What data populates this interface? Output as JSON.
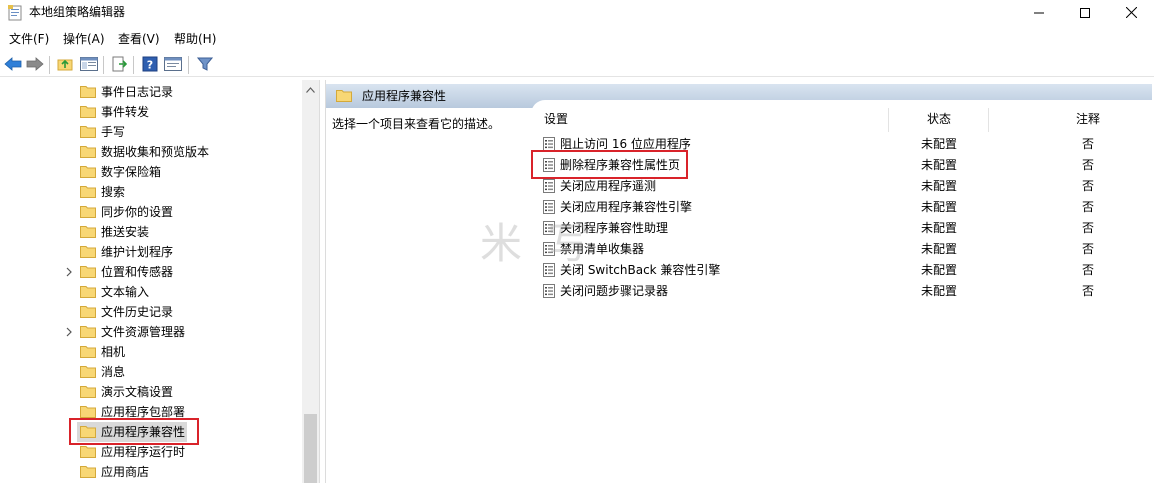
{
  "window": {
    "title": "本地组策略编辑器",
    "minimize_icon": "minimize-icon",
    "maximize_icon": "maximize-icon",
    "close_icon": "close-icon"
  },
  "menu": {
    "items": [
      "文件(F)",
      "操作(A)",
      "查看(V)",
      "帮助(H)"
    ]
  },
  "toolbar": {
    "icons": [
      "back-arrow-icon",
      "forward-arrow-icon",
      "up-folder-icon",
      "show-hide-tree-icon",
      "export-list-icon",
      "help-icon",
      "properties-icon",
      "filter-icon"
    ]
  },
  "tree": {
    "items": [
      {
        "label": "事件日志记录",
        "expandable": false
      },
      {
        "label": "事件转发",
        "expandable": false
      },
      {
        "label": "手写",
        "expandable": false
      },
      {
        "label": "数据收集和预览版本",
        "expandable": false
      },
      {
        "label": "数字保险箱",
        "expandable": false
      },
      {
        "label": "搜索",
        "expandable": false
      },
      {
        "label": "同步你的设置",
        "expandable": false
      },
      {
        "label": "推送安装",
        "expandable": false
      },
      {
        "label": "维护计划程序",
        "expandable": false
      },
      {
        "label": "位置和传感器",
        "expandable": true
      },
      {
        "label": "文本输入",
        "expandable": false
      },
      {
        "label": "文件历史记录",
        "expandable": false
      },
      {
        "label": "文件资源管理器",
        "expandable": true
      },
      {
        "label": "相机",
        "expandable": false
      },
      {
        "label": "消息",
        "expandable": false
      },
      {
        "label": "演示文稿设置",
        "expandable": false
      },
      {
        "label": "应用程序包部署",
        "expandable": false
      },
      {
        "label": "应用程序兼容性",
        "expandable": false,
        "selected": true
      },
      {
        "label": "应用程序运行时",
        "expandable": false
      },
      {
        "label": "应用商店",
        "expandable": false
      }
    ]
  },
  "pane": {
    "header_title": "应用程序兼容性",
    "description": "选择一个项目来查看它的描述。",
    "columns": {
      "setting": "设置",
      "state": "状态",
      "comment": "注释"
    },
    "rows": [
      {
        "label": "阻止访问 16 位应用程序",
        "state": "未配置",
        "comment": "否"
      },
      {
        "label": "删除程序兼容性属性页",
        "state": "未配置",
        "comment": "否",
        "highlighted": true
      },
      {
        "label": "关闭应用程序遥测",
        "state": "未配置",
        "comment": "否"
      },
      {
        "label": "关闭应用程序兼容性引擎",
        "state": "未配置",
        "comment": "否"
      },
      {
        "label": "关闭程序兼容性助理",
        "state": "未配置",
        "comment": "否"
      },
      {
        "label": "禁用清单收集器",
        "state": "未配置",
        "comment": "否"
      },
      {
        "label": "关闭 SwitchBack 兼容性引擎",
        "state": "未配置",
        "comment": "否"
      },
      {
        "label": "关闭问题步骤记录器",
        "state": "未配置",
        "comment": "否"
      }
    ]
  },
  "colors": {
    "highlight_border": "#d9232a",
    "selected_bg": "#d9d9d9",
    "header_gradient_top": "#d9e4f0",
    "header_gradient_bottom": "#b8c9dd",
    "folder_fill": "#f8d775",
    "folder_stroke": "#d4a93a"
  }
}
